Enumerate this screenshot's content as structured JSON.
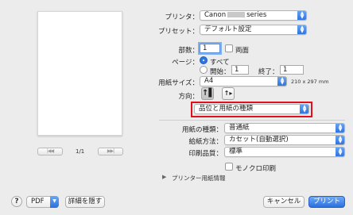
{
  "preview": {
    "page_indicator": "1/1",
    "first_btn": "|◀◀",
    "prev_btn": "◀",
    "next_btn": "▶",
    "last_btn": "▶▶|"
  },
  "printer": {
    "label": "プリンタ：",
    "value_prefix": "Canon",
    "value_suffix": "series"
  },
  "preset": {
    "label": "プリセット：",
    "value": "デフォルト設定"
  },
  "copies": {
    "label": "部数：",
    "value": "1",
    "two_sided_label": "両面"
  },
  "pages": {
    "label": "ページ：",
    "all_label": "すべて",
    "from_label": "開始：",
    "from_value": "1",
    "to_label": "終了：",
    "to_value": "1"
  },
  "paper_size": {
    "label": "用紙サイズ：",
    "value": "A4",
    "dimensions": "210 x 297 mm"
  },
  "orientation": {
    "label": "方向："
  },
  "section_menu": {
    "value": "品位と用紙の種類"
  },
  "media_type": {
    "label": "用紙の種類：",
    "value": "普通紙"
  },
  "paper_source": {
    "label": "給紙方法：",
    "value": "カセット(自動選択)"
  },
  "print_quality": {
    "label": "印刷品質：",
    "value": "標準"
  },
  "grayscale": {
    "label": "モノクロ印刷"
  },
  "printer_paper_info": {
    "label": "プリンター用紙情報"
  },
  "footer": {
    "help": "?",
    "pdf": "PDF",
    "hide_details": "詳細を隠す",
    "cancel": "キャンセル",
    "print": "プリント"
  }
}
